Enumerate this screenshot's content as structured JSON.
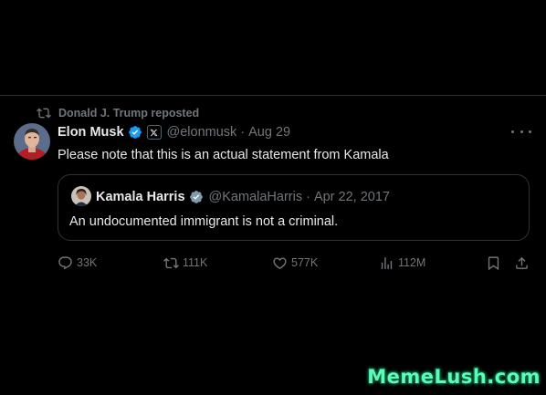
{
  "repost": {
    "icon": "repost-icon",
    "label": "Donald J. Trump reposted"
  },
  "tweet": {
    "author_name": "Elon Musk",
    "verified_icon": "verified-badge-icon",
    "affiliation_icon": "x-logo-icon",
    "handle": "@elonmusk",
    "separator": "·",
    "date": "Aug 29",
    "text": "Please note that this is an actual statement from Kamala",
    "more_icon": "more-options-icon"
  },
  "quote": {
    "author_name": "Kamala Harris",
    "verified_icon": "verified-badge-icon",
    "handle": "@KamalaHarris",
    "separator": "·",
    "date": "Apr 22, 2017",
    "text": "An undocumented immigrant is not a criminal."
  },
  "actions": {
    "reply": {
      "icon": "reply-icon",
      "count": "33K"
    },
    "repost": {
      "icon": "repost-icon",
      "count": "111K"
    },
    "like": {
      "icon": "heart-icon",
      "count": "577K"
    },
    "views": {
      "icon": "views-chart-icon",
      "count": "112M"
    },
    "bookmark": {
      "icon": "bookmark-icon"
    },
    "share": {
      "icon": "share-icon"
    }
  },
  "watermark": "MemeLush.com",
  "colors": {
    "background": "#000000",
    "primary_text": "#e7e9ea",
    "secondary_text": "#71767b",
    "border": "#2f3336",
    "verified": "#1d9bf0",
    "watermark": "#5dfbb8"
  }
}
